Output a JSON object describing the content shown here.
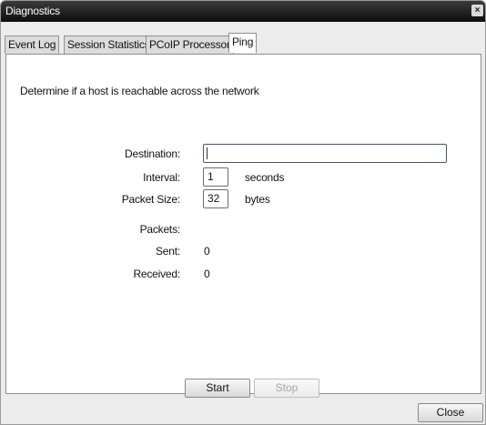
{
  "window": {
    "title": "Diagnostics",
    "close_glyph": "×"
  },
  "tabs": [
    {
      "label": "Event Log"
    },
    {
      "label": "Session Statistics"
    },
    {
      "label": "PCoIP Processor"
    },
    {
      "label": "Ping"
    }
  ],
  "ping": {
    "description": "Determine if a host is reachable across the network",
    "destination_label": "Destination:",
    "destination_value": "",
    "interval_label": "Interval:",
    "interval_value": "1",
    "interval_unit": "seconds",
    "packet_size_label": "Packet Size:",
    "packet_size_value": "32",
    "packet_size_unit": "bytes",
    "packets_label": "Packets:",
    "sent_label": "Sent:",
    "sent_value": "0",
    "received_label": "Received:",
    "received_value": "0",
    "start_label": "Start",
    "stop_label": "Stop"
  },
  "footer": {
    "close_label": "Close"
  }
}
